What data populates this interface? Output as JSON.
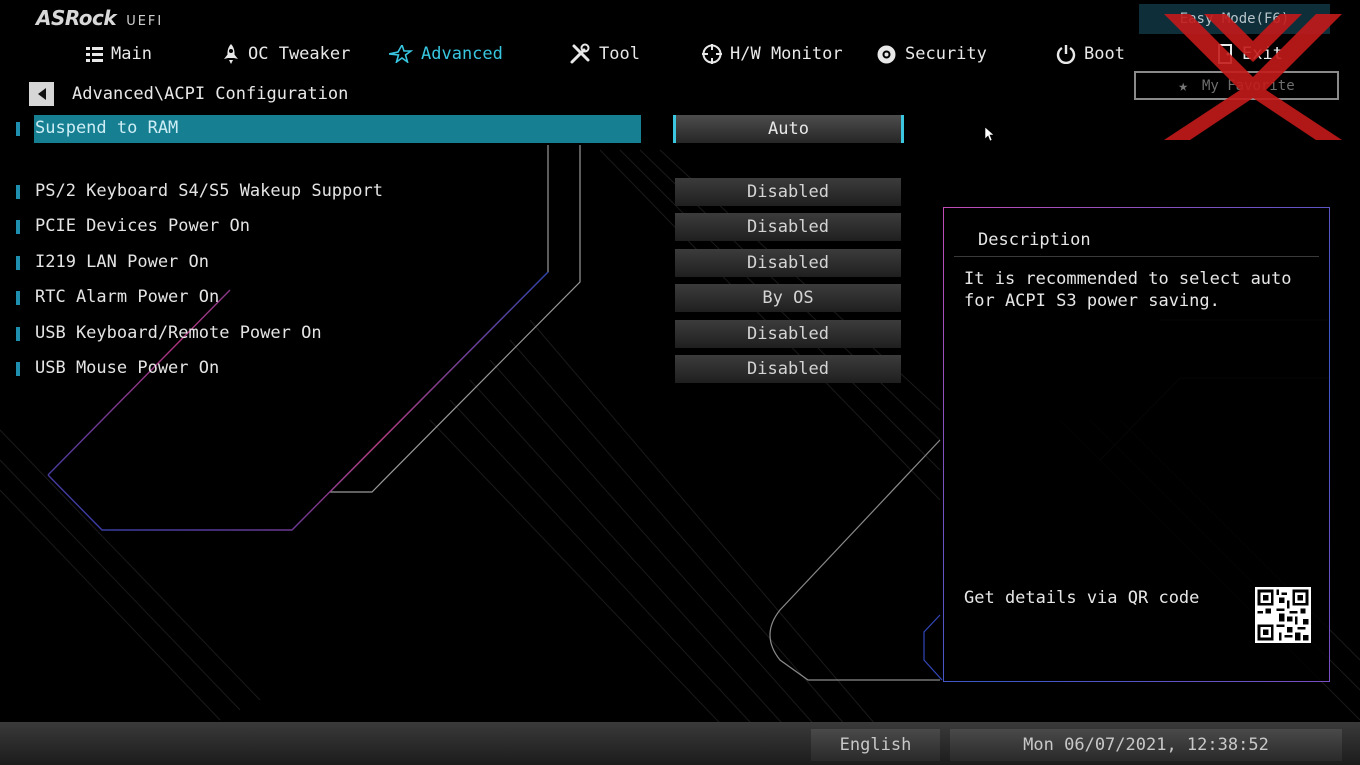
{
  "brand": {
    "name": "ASRock",
    "suffix": "UEFI"
  },
  "nav": {
    "items": [
      {
        "label": "Main",
        "icon": "list-icon"
      },
      {
        "label": "OC Tweaker",
        "icon": "rocket-icon"
      },
      {
        "label": "Advanced",
        "icon": "star-icon",
        "active": true
      },
      {
        "label": "Tool",
        "icon": "tools-icon"
      },
      {
        "label": "H/W Monitor",
        "icon": "crosshair-icon"
      },
      {
        "label": "Security",
        "icon": "shield-gear-icon"
      },
      {
        "label": "Boot",
        "icon": "power-icon"
      },
      {
        "label": "Exit",
        "icon": "exit-door-icon"
      }
    ]
  },
  "easy_mode_label": "Easy Mode(F6)",
  "favorite_label": "My Favorite",
  "breadcrumb": "Advanced\\ACPI Configuration",
  "settings": [
    {
      "label": "Suspend to RAM",
      "value": "Auto",
      "selected": true
    },
    {
      "label": "PS/2 Keyboard S4/S5 Wakeup Support",
      "value": "Disabled"
    },
    {
      "label": "PCIE Devices Power On",
      "value": "Disabled"
    },
    {
      "label": "I219 LAN Power On",
      "value": "Disabled"
    },
    {
      "label": "RTC Alarm Power On",
      "value": "By OS"
    },
    {
      "label": "USB Keyboard/Remote Power On",
      "value": "Disabled"
    },
    {
      "label": "USB Mouse Power On",
      "value": "Disabled"
    }
  ],
  "description": {
    "title": "Description",
    "text": "It is recommended to select auto for ACPI S3 power saving.",
    "qr_label": "Get details via QR code"
  },
  "footer": {
    "language": "English",
    "datetime": "Mon 06/07/2021, 12:38:52"
  },
  "colors": {
    "accent": "#38c6e0",
    "selection": "#177f92",
    "watermark": "#c41a1a"
  }
}
